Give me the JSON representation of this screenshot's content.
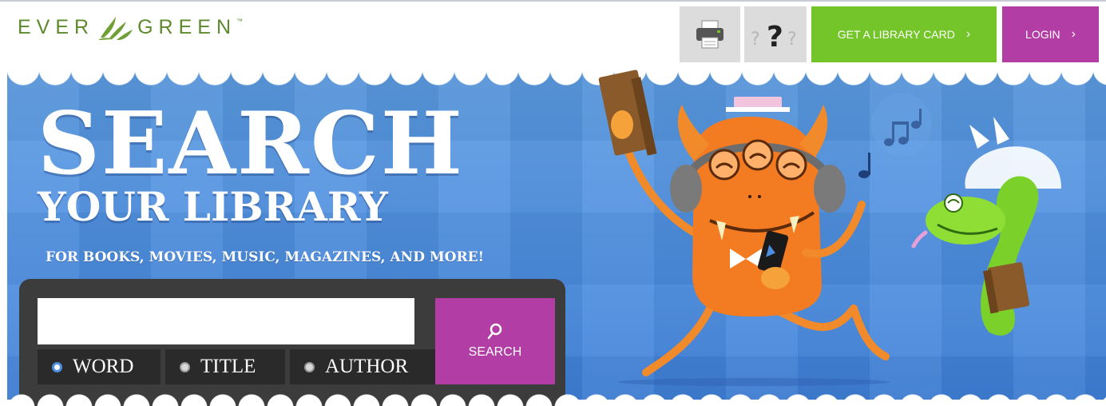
{
  "header": {
    "logo": {
      "left": "EVER",
      "right": "GREEN",
      "tm": "™"
    },
    "print_icon": "printer-icon",
    "help_icon": "question-marks-icon",
    "library_card_label": "GET A LIBRARY CARD",
    "login_label": "LOGIN",
    "chevron": "›"
  },
  "hero": {
    "title_line1": "SEARCH",
    "title_line2": "YOUR LIBRARY",
    "subtitle": "FOR BOOKS, MOVIES, MUSIC, MAGAZINES, AND MORE!"
  },
  "search": {
    "query_value": "",
    "button_label": "SEARCH",
    "options": [
      {
        "label": "WORD",
        "selected": true
      },
      {
        "label": "TITLE",
        "selected": false
      },
      {
        "label": "AUTHOR",
        "selected": false
      }
    ]
  },
  "colors": {
    "brand_green": "#74c52a",
    "brand_purple": "#b23da4",
    "hero_blue": "#4d8ee0",
    "logo_green": "#5e8a2d"
  }
}
